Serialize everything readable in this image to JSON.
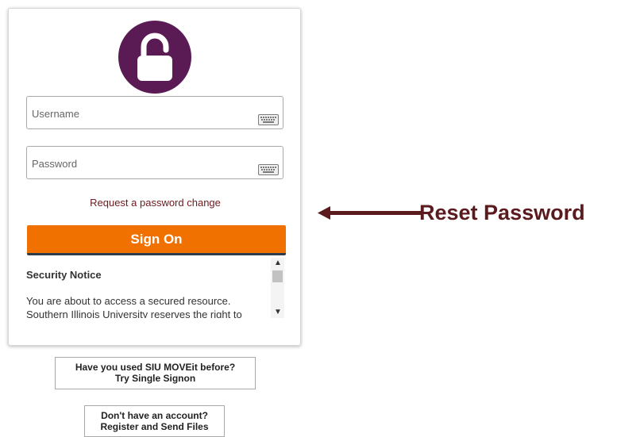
{
  "login": {
    "username_placeholder": "Username",
    "password_placeholder": "Password",
    "request_link": "Request a password change",
    "signon_label": "Sign On",
    "notice_title": "Security Notice",
    "notice_text": "You are about to access a secured resource. Southern Illinois University reserves the right to"
  },
  "buttons": {
    "sso_line1": "Have you used SIU MOVEit before?",
    "sso_line2": "Try Single Signon",
    "register_line1": "Don't have an account?",
    "register_line2": "Register and Send Files"
  },
  "annotation": {
    "label": "Reset Password"
  },
  "colors": {
    "lock_circle": "#5a1b55",
    "signon_button": "#f07000",
    "link_text": "#6b1a1e",
    "annotation": "#5b1b1e"
  },
  "icons": {
    "lock": "lock-icon",
    "keyboard": "keyboard-icon",
    "arrow": "left-arrow-icon"
  }
}
